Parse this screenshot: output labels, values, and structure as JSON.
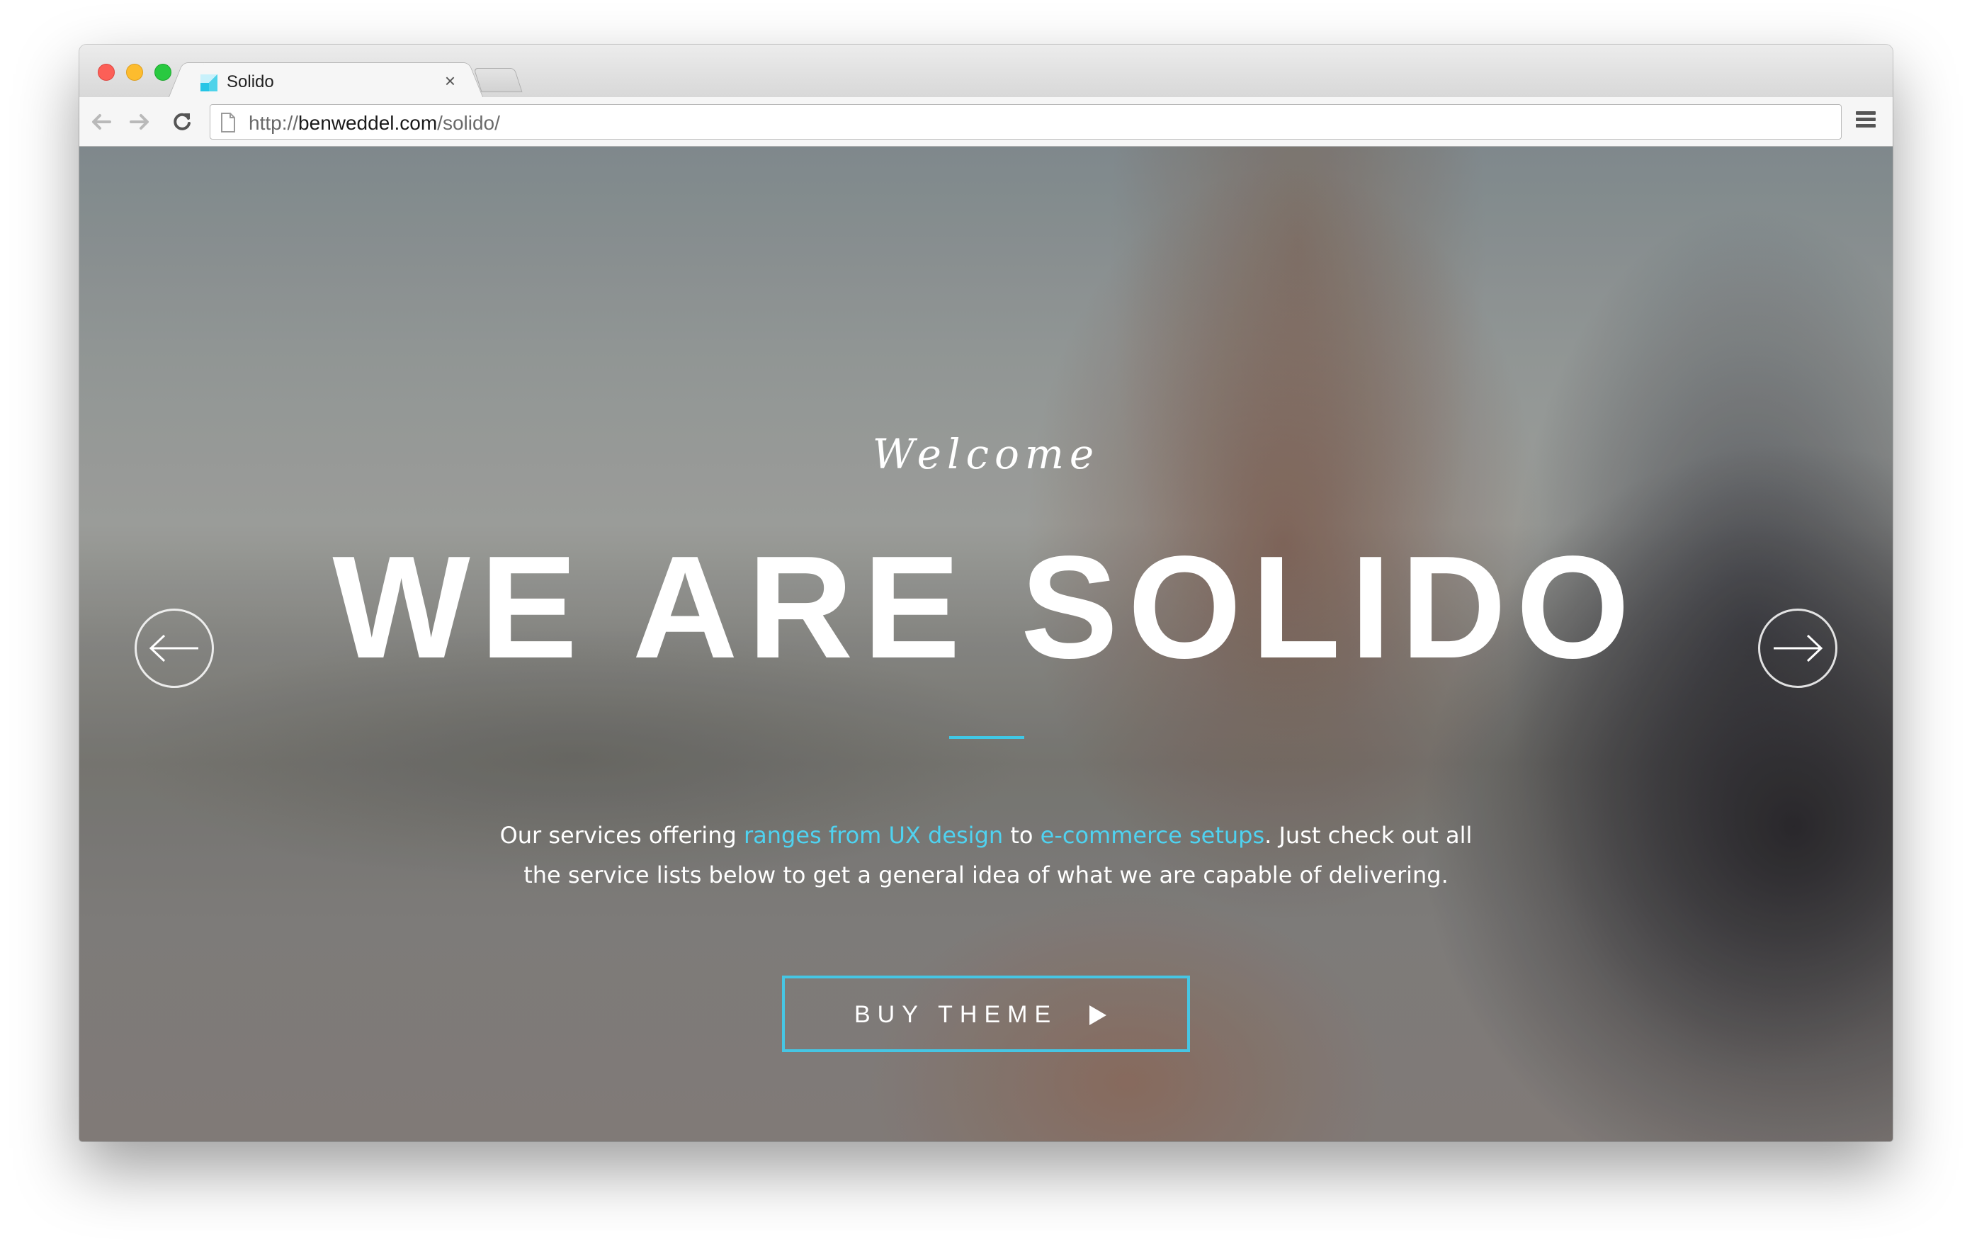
{
  "browser": {
    "tab_title": "Solido",
    "tab_close": "×",
    "url_prefix": "http://",
    "url_domain": "benweddel.com",
    "url_path": "/solido/",
    "icons": {
      "back": "arrow-left-icon",
      "forward": "arrow-right-icon",
      "reload": "reload-icon",
      "page": "page-icon",
      "menu": "hamburger-menu-icon"
    }
  },
  "hero": {
    "welcome": "Welcome",
    "headline": "WE ARE SOLIDO",
    "description": {
      "part1": "Our services offering ",
      "link1": "ranges from UX design",
      "part2": " to ",
      "link2": "e-commerce setups",
      "part3": ". Just check out all the service lists below to get a general idea of what we are capable of delivering."
    },
    "cta_label": "BUY THEME",
    "accent_color": "#46c6e4"
  },
  "slider": {
    "prev_icon": "arrow-left-circle-icon",
    "next_icon": "arrow-right-circle-icon"
  }
}
